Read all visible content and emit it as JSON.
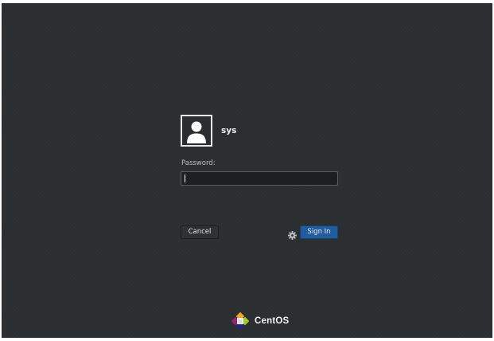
{
  "user": {
    "name": "sys",
    "avatar_icon": "user-silhouette-icon"
  },
  "password": {
    "label": "Password:",
    "value": ""
  },
  "buttons": {
    "cancel_label": "Cancel",
    "signin_label": "Sign In",
    "session_icon": "gear-icon"
  },
  "branding": {
    "logo_icon": "centos-logo-icon",
    "text": "CentOS"
  },
  "colors": {
    "background": "#2c2f31",
    "accent": "#215d9c"
  }
}
